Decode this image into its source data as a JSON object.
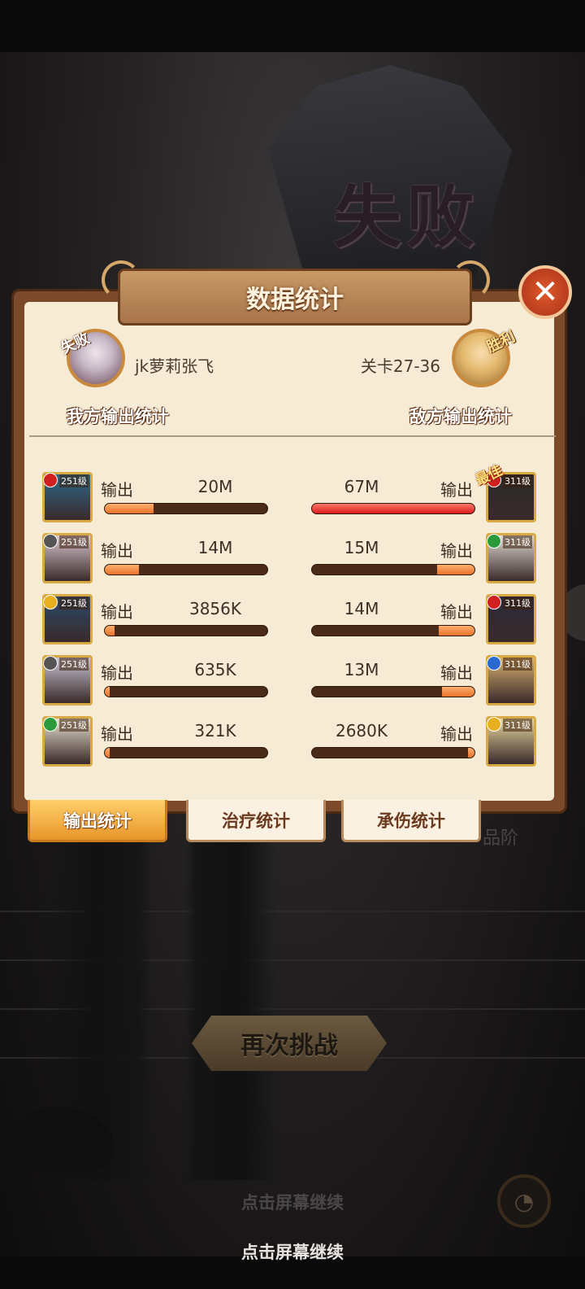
{
  "screen": {
    "defeat_banner": "失败",
    "panel_title": "数据统计",
    "close_glyph": "✕",
    "hint_dim": "点击屏幕继续",
    "hint": "点击屏幕继续",
    "retry_label": "再次挑战",
    "grade_text": "品阶"
  },
  "ally": {
    "result_tag": "失败",
    "name": "jk萝莉张飞",
    "section_title": "我方输出统计"
  },
  "enemy": {
    "result_tag": "胜利",
    "name": "关卡27-36",
    "section_title": "敌方输出统计"
  },
  "row_label": "输出",
  "best_tag": "最佳",
  "ally_heroes": [
    {
      "level": "251级",
      "output": "20M",
      "ratio": 0.3,
      "bg": "#2a6a8a",
      "faction": "#d02020"
    },
    {
      "level": "251级",
      "output": "14M",
      "ratio": 0.21,
      "bg": "#d8c8d0",
      "faction": "#555555"
    },
    {
      "level": "251级",
      "output": "3856K",
      "ratio": 0.06,
      "bg": "#2a4a6a",
      "faction": "#e8b020"
    },
    {
      "level": "251级",
      "output": "635K",
      "ratio": 0.01,
      "bg": "#c8c4d4",
      "faction": "#555555"
    },
    {
      "level": "251级",
      "output": "321K",
      "ratio": 0.005,
      "bg": "#e8e0d0",
      "faction": "#2a9a3a"
    }
  ],
  "enemy_heroes": [
    {
      "level": "311级",
      "output": "67M",
      "ratio": 1.0,
      "bg": "#2a2a2a",
      "faction": "#d02020",
      "best": true
    },
    {
      "level": "311级",
      "output": "15M",
      "ratio": 0.23,
      "bg": "#e0dcd0",
      "faction": "#2a9a3a"
    },
    {
      "level": "311级",
      "output": "14M",
      "ratio": 0.22,
      "bg": "#2a2a3a",
      "faction": "#d02020"
    },
    {
      "level": "311级",
      "output": "13M",
      "ratio": 0.2,
      "bg": "#d8b070",
      "faction": "#2a6ad0"
    },
    {
      "level": "311级",
      "output": "2680K",
      "ratio": 0.04,
      "bg": "#e8d8a0",
      "faction": "#e8b020"
    }
  ],
  "tabs": [
    {
      "label": "输出统计",
      "active": true
    },
    {
      "label": "治疗统计",
      "active": false
    },
    {
      "label": "承伤统计",
      "active": false
    }
  ]
}
